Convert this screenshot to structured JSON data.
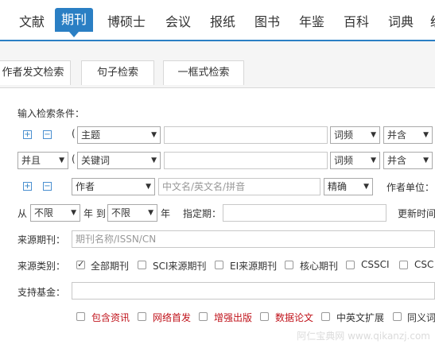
{
  "nav": {
    "items": [
      "文献",
      "期刊",
      "博硕士",
      "会议",
      "报纸",
      "图书",
      "年鉴",
      "百科",
      "词典",
      "统"
    ]
  },
  "tabs": [
    "作者发文检索",
    "句子检索",
    "一框式检索"
  ],
  "form": {
    "section_title": "输入检索条件：",
    "row1": {
      "paren": "(",
      "field": "主题",
      "freq": "词频",
      "logic": "并含"
    },
    "row2": {
      "op": "并且",
      "paren": "(",
      "field": "关键词",
      "freq": "词频",
      "logic": "并含"
    },
    "row3": {
      "field": "作者",
      "placeholder": "中文名/英文名/拼音",
      "match": "精确",
      "unit_label": "作者单位："
    },
    "row4": {
      "from": "从",
      "from_val": "不限",
      "year_to": "年 到",
      "to_val": "不限",
      "year": "年",
      "date_label": "指定期：",
      "update_label": "更新时间"
    },
    "source_label": "来源期刊：",
    "source_placeholder": "期刊名称/ISSN/CN",
    "category_label": "来源类别：",
    "categories": [
      "全部期刊",
      "SCI来源期刊",
      "EI来源期刊",
      "核心期刊",
      "CSSCI",
      "CSC"
    ],
    "fund_label": "支持基金：",
    "options": [
      "包含资讯",
      "网络首发",
      "增强出版",
      "数据论文",
      "中英文扩展",
      "同义词"
    ]
  },
  "watermark": "阿仁宝典网 www.qikanzj.com",
  "colors": {
    "accent": "#2a7fc4",
    "red_text": "#c0131b"
  }
}
